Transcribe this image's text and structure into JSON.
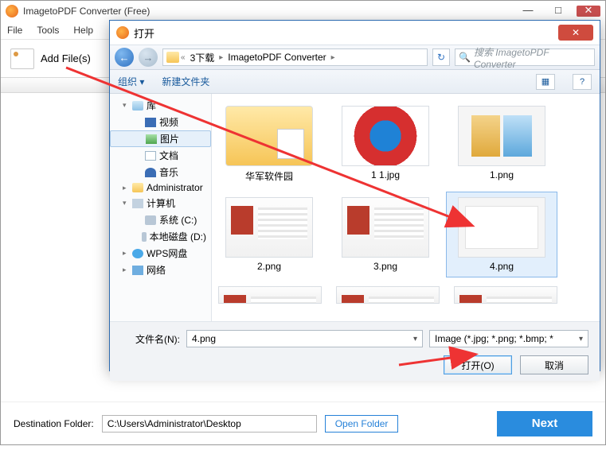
{
  "app": {
    "title": "ImagetoPDF Converter (Free)"
  },
  "menu": {
    "file": "File",
    "tools": "Tools",
    "help": "Help"
  },
  "toolbar": {
    "addfile": "Add File(s)"
  },
  "bottom": {
    "dest_label": "Destination Folder:",
    "dest_value": "C:\\Users\\Administrator\\Desktop",
    "open_folder": "Open Folder",
    "next": "Next"
  },
  "window_controls": {
    "min": "—",
    "max": "□",
    "close": "✕"
  },
  "dialog": {
    "title": "打开",
    "close": "✕",
    "nav": {
      "back": "←",
      "forward": "→",
      "crumbs": [
        "3下载",
        "ImagetoPDF Converter"
      ],
      "crumb_sep": "▸",
      "crumb_prefix": "«",
      "refresh": "↻",
      "search_placeholder": "搜索 ImagetoPDF Converter",
      "search_icon": "🔍"
    },
    "toolbar": {
      "organize": "组织 ▾",
      "newfolder": "新建文件夹",
      "view_icon": "▦",
      "help_icon": "?"
    },
    "tree": [
      {
        "icon": "lib",
        "label": "库",
        "arrow": "▾"
      },
      {
        "icon": "vid",
        "label": "视频",
        "level": 2
      },
      {
        "icon": "pic",
        "label": "图片",
        "level": 2,
        "selected": true
      },
      {
        "icon": "doc",
        "label": "文档",
        "level": 2
      },
      {
        "icon": "mus",
        "label": "音乐",
        "level": 2
      },
      {
        "icon": "usr",
        "label": "Administrator",
        "arrow": "▸"
      },
      {
        "icon": "comp",
        "label": "计算机",
        "arrow": "▾"
      },
      {
        "icon": "drv",
        "label": "系统 (C:)",
        "level": 2
      },
      {
        "icon": "drv",
        "label": "本地磁盘 (D:)",
        "level": 2
      },
      {
        "icon": "wps",
        "label": "WPS网盘",
        "arrow": "▸"
      },
      {
        "icon": "net",
        "label": "网络",
        "arrow": "▸"
      }
    ],
    "files": [
      {
        "name": "华军软件园",
        "type": "folder"
      },
      {
        "name": "1 1.jpg",
        "type": "jpg"
      },
      {
        "name": "1.png",
        "type": "png1"
      },
      {
        "name": "2.png",
        "type": "screenshot"
      },
      {
        "name": "3.png",
        "type": "screenshot"
      },
      {
        "name": "4.png",
        "type": "screenshot4",
        "selected": true
      },
      {
        "name": "",
        "type": "row"
      },
      {
        "name": "",
        "type": "row"
      },
      {
        "name": "",
        "type": "row"
      }
    ],
    "footer": {
      "fname_label": "文件名(N):",
      "fname_value": "4.png",
      "filter": "Image (*.jpg; *.png; *.bmp; *",
      "open": "打开(O)",
      "cancel": "取消"
    }
  }
}
